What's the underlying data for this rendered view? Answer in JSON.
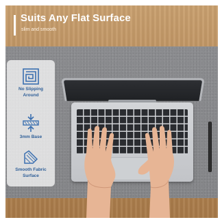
{
  "headline": {
    "title": "Suits Any Flat Surface",
    "subtitle": "slim and smooth"
  },
  "features": [
    {
      "icon": "maze-grip-icon",
      "label_line1": "No Slipping",
      "label_line2": "Around"
    },
    {
      "icon": "thickness-arrows-icon",
      "label_line1": "3mm Base",
      "label_line2": ""
    },
    {
      "icon": "fabric-texture-icon",
      "label_line1": "Smooth Fabric",
      "label_line2": "Surface"
    }
  ],
  "colors": {
    "title_text": "#ffffff",
    "feature_label": "#2f5f98",
    "icon_blue": "#3a6fb0",
    "mat_gray": "#88898c",
    "desk_wood": "#b98d5c"
  }
}
